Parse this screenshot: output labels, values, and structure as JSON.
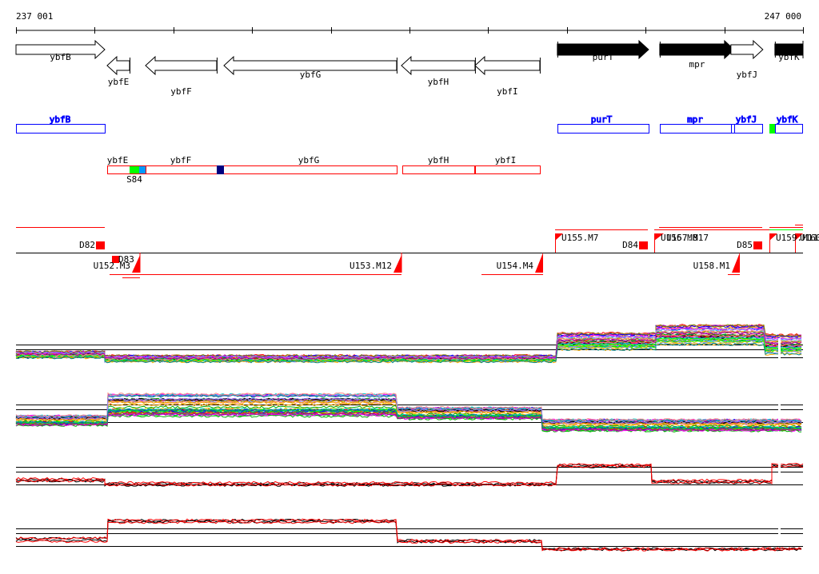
{
  "ruler": {
    "start_label": "237 001",
    "end_label": "247 000",
    "start": 237001,
    "end": 247000
  },
  "genes": [
    {
      "name": "ybfB",
      "start": 237001,
      "end": 238129,
      "strand": "+",
      "fill": "white"
    },
    {
      "name": "ybfE",
      "start": 238159,
      "end": 238444,
      "strand": "-",
      "fill": "white"
    },
    {
      "name": "ybfF",
      "start": 238647,
      "end": 239551,
      "strand": "-",
      "fill": "white"
    },
    {
      "name": "ybfG",
      "start": 239643,
      "end": 241837,
      "strand": "-",
      "fill": "white"
    },
    {
      "name": "ybfH",
      "start": 241898,
      "end": 242833,
      "strand": "-",
      "fill": "white"
    },
    {
      "name": "ybfI",
      "start": 242833,
      "end": 243656,
      "strand": "-",
      "fill": "white"
    },
    {
      "name": "purT",
      "start": 243879,
      "end": 245038,
      "strand": "+",
      "fill": "black"
    },
    {
      "name": "mpr",
      "start": 245180,
      "end": 246125,
      "strand": "+",
      "fill": "black"
    },
    {
      "name": "ybfJ",
      "start": 246084,
      "end": 246490,
      "strand": "+",
      "fill": "white"
    },
    {
      "name": "ybfK",
      "start": 246643,
      "end": 247000,
      "strand": "+",
      "fill": "black"
    }
  ],
  "forward_operons": {
    "color": "#0000ff",
    "labels": [
      "ybfB",
      "purT",
      "mpr",
      "ybfJ",
      "ybfK"
    ]
  },
  "reverse_operons": {
    "color": "#ff0000",
    "labels": [
      "ybfE",
      "ybfF",
      "ybfG",
      "ybfH",
      "ybfI"
    ],
    "site_label": "S84"
  },
  "site_colors": {
    "green": "#00ff00",
    "light_blue": "#0099ff",
    "dark_blue": "#000080"
  },
  "transcription_units": {
    "above": [
      "D82",
      "U155.M7",
      "D84",
      "U156.M8",
      "U157.M17",
      "D85",
      "U159.M11",
      "U160"
    ],
    "below": [
      "D83",
      "U152.M3",
      "U153.M12",
      "U154.M4",
      "U158.M1"
    ]
  },
  "expression_tracks": {
    "series_colors": [
      "#000000",
      "#ff0000"
    ]
  }
}
